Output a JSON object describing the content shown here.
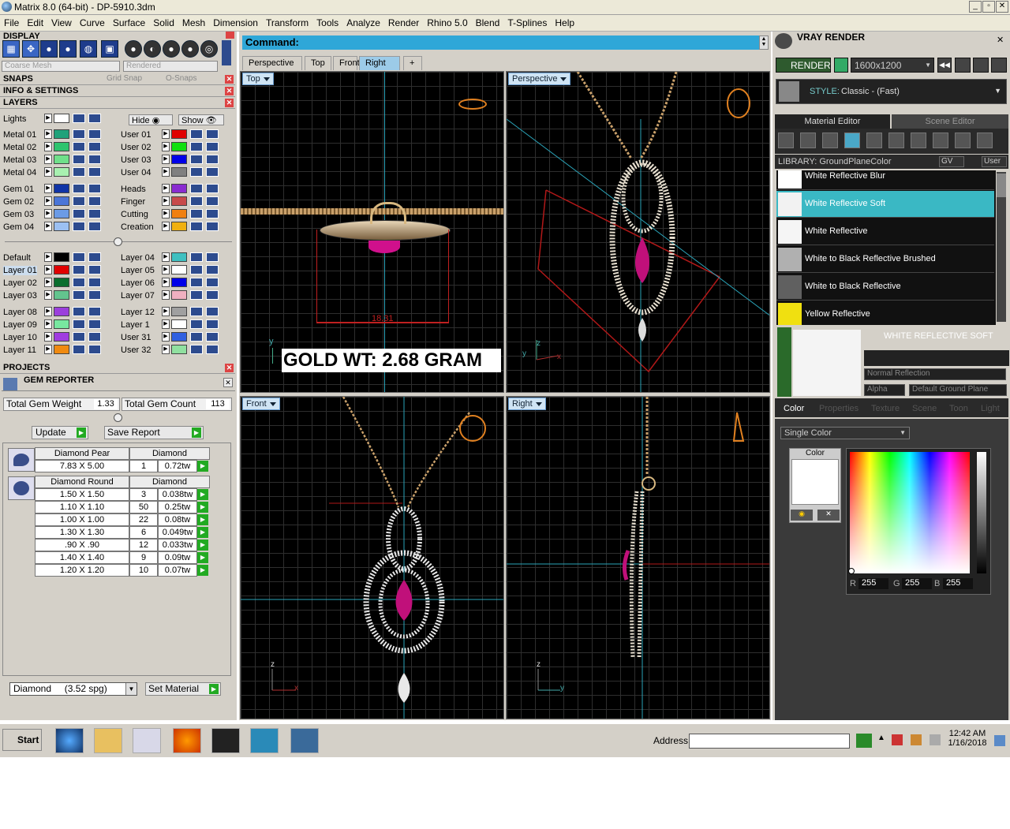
{
  "window": {
    "title": "Matrix 8.0 (64-bit) - DP-5910.3dm"
  },
  "menu": [
    "File",
    "Edit",
    "View",
    "Curve",
    "Surface",
    "Solid",
    "Mesh",
    "Dimension",
    "Transform",
    "Tools",
    "Analyze",
    "Render",
    "Rhino 5.0",
    "Blend",
    "T-Splines",
    "Help"
  ],
  "left_panel": {
    "display_header": "DISPLAY",
    "mesh_combo": "Coarse Mesh",
    "render_combo": "Rendered",
    "snaps": {
      "label": "SNAPS",
      "grid_snap": "Grid Snap",
      "osnaps": "O-Snaps"
    },
    "info_settings": "INFO & SETTINGS",
    "layers_header": "LAYERS",
    "lights": "Lights",
    "hide": "Hide",
    "show": "Show",
    "layers_left": [
      {
        "name": "Metal 01",
        "color": "#1fa27a"
      },
      {
        "name": "Metal 02",
        "color": "#2ec46e"
      },
      {
        "name": "Metal 03",
        "color": "#6fe08a"
      },
      {
        "name": "Metal 04",
        "color": "#a8f0b0"
      },
      {
        "name": "Gem 01",
        "color": "#1034a6"
      },
      {
        "name": "Gem 02",
        "color": "#4b76d8"
      },
      {
        "name": "Gem 03",
        "color": "#6b9be6"
      },
      {
        "name": "Gem 04",
        "color": "#9cc0f2"
      },
      {
        "name": "Default",
        "color": "#000000"
      },
      {
        "name": "Layer 01",
        "color": "#e00000"
      },
      {
        "name": "Layer 02",
        "color": "#0a6e2e"
      },
      {
        "name": "Layer 03",
        "color": "#63c48e"
      },
      {
        "name": "Layer 08",
        "color": "#9b3fdc"
      },
      {
        "name": "Layer 09",
        "color": "#78e8a0"
      },
      {
        "name": "Layer 10",
        "color": "#a03ce0"
      },
      {
        "name": "Layer 11",
        "color": "#f08a10"
      }
    ],
    "layers_right": [
      {
        "name": "User 01",
        "color": "#e00000"
      },
      {
        "name": "User 02",
        "color": "#10e010"
      },
      {
        "name": "User 03",
        "color": "#0000e8"
      },
      {
        "name": "User 04",
        "color": "#808080"
      },
      {
        "name": "Heads",
        "color": "#8a2bd0"
      },
      {
        "name": "Finger",
        "color": "#c84a4a"
      },
      {
        "name": "Cutting",
        "color": "#f08010"
      },
      {
        "name": "Creation",
        "color": "#f0b010"
      },
      {
        "name": "Layer 04",
        "color": "#3fc0c0"
      },
      {
        "name": "Layer 05",
        "color": "#ffffff"
      },
      {
        "name": "Layer 06",
        "color": "#0000e8"
      },
      {
        "name": "Layer 07",
        "color": "#f0b0c0"
      },
      {
        "name": "Layer 12",
        "color": "#a0a0a0"
      },
      {
        "name": "Layer 1",
        "color": "#ffffff"
      },
      {
        "name": "User 31",
        "color": "#3060e0"
      },
      {
        "name": "User 32",
        "color": "#90e0a0"
      }
    ],
    "projects": "PROJECTS",
    "gem_reporter": "GEM REPORTER",
    "total_gem_weight_label": "Total Gem Weight",
    "total_gem_weight": "1.33",
    "total_gem_count_label": "Total Gem Count",
    "total_gem_count": "113",
    "update": "Update",
    "save_report": "Save Report",
    "gem_groups": [
      {
        "shape": "Diamond Pear",
        "type": "Diamond",
        "rows": [
          [
            "7.83 X 5.00",
            "1",
            "0.72tw"
          ]
        ]
      },
      {
        "shape": "Diamond Round",
        "type": "Diamond",
        "rows": [
          [
            "1.50 X 1.50",
            "3",
            "0.038tw"
          ],
          [
            "1.10 X 1.10",
            "50",
            "0.25tw"
          ],
          [
            "1.00 X 1.00",
            "22",
            "0.08tw"
          ],
          [
            "1.30 X 1.30",
            "6",
            "0.049tw"
          ],
          [
            ".90 X .90",
            "12",
            "0.033tw"
          ],
          [
            "1.40 X 1.40",
            "9",
            "0.09tw"
          ],
          [
            "1.20 X 1.20",
            "10",
            "0.07tw"
          ]
        ]
      }
    ],
    "material_select": "Diamond     (3.52 spg)",
    "set_material": "Set Material"
  },
  "viewports": {
    "command": "Command:",
    "tabs": [
      "Perspective",
      "Top",
      "Front",
      "Right"
    ],
    "add_tab": "+",
    "top": "Top",
    "perspective": "Perspective",
    "front": "Front",
    "right": "Right",
    "dimension": "18.31",
    "gold_weight": "GOLD WT: 2.68 GRAM",
    "axis_y": "y",
    "axis_z": "z",
    "axis_x": "x"
  },
  "right_panel": {
    "title": "VRAY RENDER",
    "render": "RENDER",
    "resolution": "1600x1200",
    "style_label": "STYLE:",
    "style_value": "Classic - (Fast)",
    "tab_material": "Material Editor",
    "tab_scene": "Scene Editor",
    "library_label": "LIBRARY: GroundPlaneColor",
    "gv": "GV",
    "user": "User",
    "materials": [
      {
        "name": "White Reflective Blur",
        "color": "#ffffff"
      },
      {
        "name": "White Reflective Soft",
        "color": "#f2f2f2"
      },
      {
        "name": "White Reflective",
        "color": "#f5f5f5"
      },
      {
        "name": "White to Black Reflective Brushed",
        "color": "#b0b0b0"
      },
      {
        "name": "White to Black Reflective",
        "color": "#606060"
      },
      {
        "name": "Yellow Reflective",
        "color": "#f0e010"
      }
    ],
    "selected_material": "WHITE REFLECTIVE SOFT",
    "reflection": "Normal Reflection",
    "alpha": "Alpha",
    "default_ground": "Default Ground Plane",
    "prop_tabs": [
      "Color",
      "Properties",
      "Texture",
      "Scene",
      "Toon",
      "Light"
    ],
    "single_color": "Single Color",
    "color_label": "Color",
    "r_label": "R",
    "r": "255",
    "g_label": "G",
    "g": "255",
    "b_label": "B",
    "b": "255"
  },
  "taskbar": {
    "start": "Start",
    "address": "Address",
    "time": "12:42 AM",
    "date": "1/16/2018"
  }
}
